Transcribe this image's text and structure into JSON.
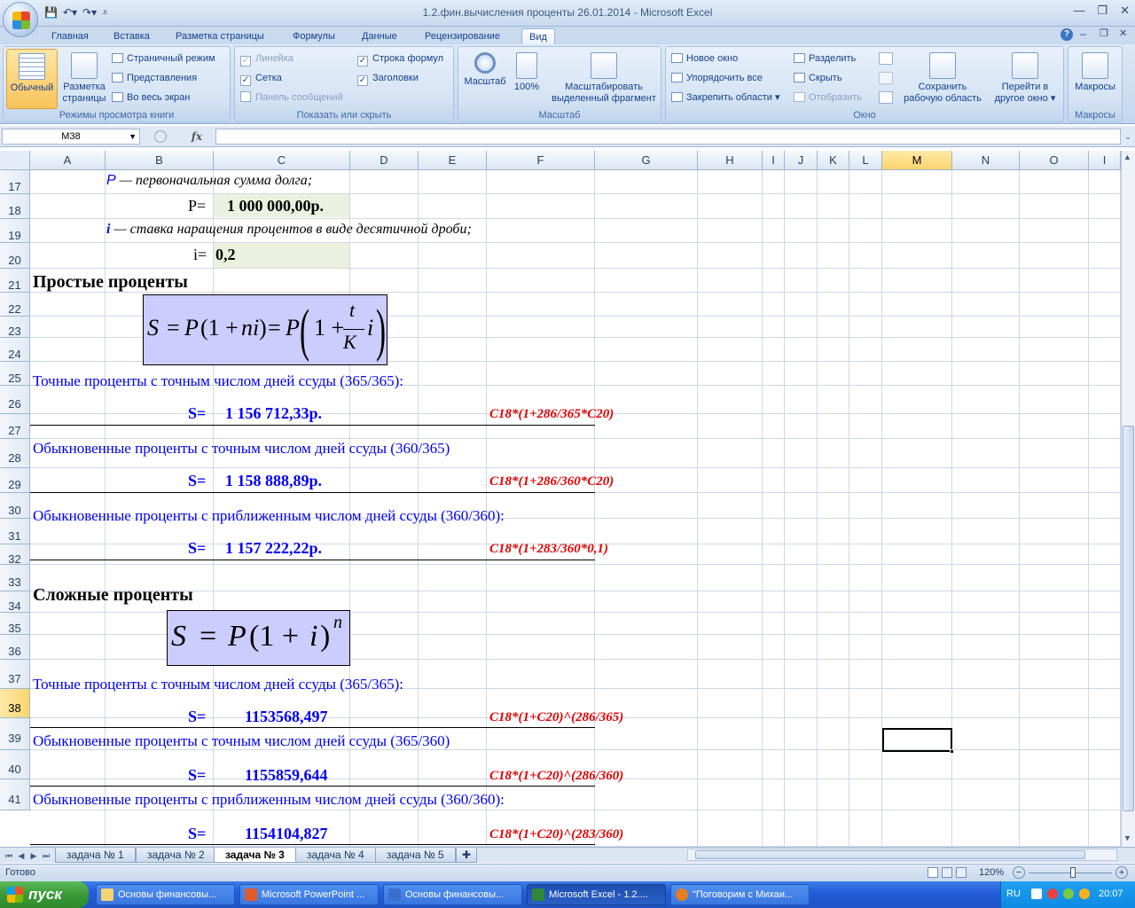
{
  "window": {
    "title": "1.2.фин.вычисления проценты 26.01.2014 - Microsoft Excel",
    "controls": [
      "—",
      "❐",
      "✕"
    ]
  },
  "ribbon": {
    "tabs": [
      "Главная",
      "Вставка",
      "Разметка страницы",
      "Формулы",
      "Данные",
      "Рецензирование",
      "Вид"
    ],
    "active_tab": "Вид",
    "groups": {
      "views": {
        "label": "Режимы просмотра книги",
        "normal": "Обычный",
        "page_layout_1": "Разметка",
        "page_layout_2": "страницы",
        "page_break": "Страничный режим",
        "custom_views": "Представления",
        "full_screen": "Во весь экран"
      },
      "show": {
        "label": "Показать или скрыть",
        "ruler": "Линейка",
        "gridlines": "Сетка",
        "message_bar": "Панель сообщений",
        "formula_bar": "Строка формул",
        "headings": "Заголовки"
      },
      "zoom": {
        "label": "Масштаб",
        "zoom": "Масштаб",
        "hundred": "100%",
        "zoom_selection_1": "Масштабировать",
        "zoom_selection_2": "выделенный фрагмент"
      },
      "window": {
        "label": "Окно",
        "new_window": "Новое окно",
        "arrange_all": "Упорядочить все",
        "freeze_panes": "Закрепить области",
        "split": "Разделить",
        "hide": "Скрыть",
        "unhide": "Отобразить",
        "save_workspace_1": "Сохранить",
        "save_workspace_2": "рабочую область",
        "switch_windows_1": "Перейти в",
        "switch_windows_2": "другое окно"
      },
      "macros": {
        "label": "Макросы",
        "macros": "Макросы"
      }
    }
  },
  "formula_bar": {
    "name_box": "M38",
    "fx": "fx",
    "value": ""
  },
  "grid": {
    "columns": [
      "A",
      "B",
      "C",
      "D",
      "E",
      "F",
      "G",
      "H",
      "I",
      "J",
      "K",
      "L",
      "M",
      "N",
      "O",
      "I"
    ],
    "rows": [
      "17",
      "18",
      "19",
      "20",
      "21",
      "22",
      "23",
      "24",
      "25",
      "26",
      "27",
      "28",
      "29",
      "30",
      "31",
      "32",
      "33",
      "34",
      "35",
      "36",
      "37",
      "38",
      "39",
      "40",
      "41"
    ],
    "active_col": "M",
    "active_row": "38"
  },
  "cells": {
    "r17_sym": "P",
    "r17_text": " — первоначальная сумма долга;",
    "r18_label": "P=",
    "r18_value": "1 000 000,00р.",
    "r19_sym": "i",
    "r19_text": " — ставка наращения процентов в виде десятичной дроби;",
    "r20_label": "i=",
    "r20_value": "0,2",
    "r21_header": "Простые проценты",
    "formula1": {
      "lhs": "S",
      "eq1": "=",
      "p1": "P",
      "paren1": "(1 +",
      "ni": "ni",
      "close1": ")",
      "eq2": "=",
      "p2": "P",
      "one_plus": "1 +",
      "num": "t",
      "den": "K",
      "i": "i"
    },
    "r25_text": "Точные проценты с точным числом дней ссуды (365/365):",
    "r26_label": "S=",
    "r26_value": "1 156 712,33р.",
    "r26_formula": "C18*(1+286/365*C20)",
    "r27_text": "Обыкновенные проценты с точным числом дней ссуды (360/365)",
    "r28_label": "S=",
    "r28_value": "1 158 888,89р.",
    "r28_formula": "C18*(1+286/360*C20)",
    "r29_text": "Обыкновенные проценты с приближенным числом дней ссуды (360/360):",
    "r30_label": "S=",
    "r30_value": "1 157 222,22р.",
    "r30_formula": "C18*(1+283/360*0,1)",
    "r32_header": "Сложные проценты",
    "formula2": {
      "lhs": "S",
      "eq": "=",
      "p": "P",
      "paren": "(1 +",
      "i": "i",
      "close": ")",
      "exp": "n"
    },
    "r36_text": "Точные проценты с точным числом дней ссуды (365/365):",
    "r37_label": "S=",
    "r37_value": "1153568,497",
    "r37_formula": "C18*(1+C20)^(286/365)",
    "r38_text": "Обыкновенные проценты с точным числом дней ссуды (365/360)",
    "r39_label": "S=",
    "r39_value": "1155859,644",
    "r39_formula": "C18*(1+C20)^(286/360)",
    "r40_text": "Обыкновенные проценты с приближенным числом дней ссуды (360/360):",
    "r41_label": "S=",
    "r41_value": "1154104,827",
    "r41_formula": "C18*(1+C20)^(283/360)"
  },
  "sheets": {
    "tabs": [
      "задача № 1",
      "задача № 2",
      "задача № 3",
      "задача № 4",
      "задача № 5"
    ],
    "active": "задача № 3"
  },
  "status": {
    "ready": "Готово",
    "zoom": "120%",
    "minus": "−",
    "plus": "+"
  },
  "taskbar": {
    "start": "пуск",
    "items": [
      "Основы финансовы...",
      "Microsoft PowerPoint ...",
      "Основы финансовы...",
      "Microsoft Excel - 1.2....",
      "\"Поговорим с Михаи..."
    ],
    "active_index": 3,
    "lang": "RU",
    "time": "20:07"
  },
  "colors": {
    "blue_text": "#0000ee",
    "red_formula": "#e00000",
    "formula_box": "#ccccff",
    "input_fill": "#ebf1de",
    "active_header": "#f9d56d"
  }
}
